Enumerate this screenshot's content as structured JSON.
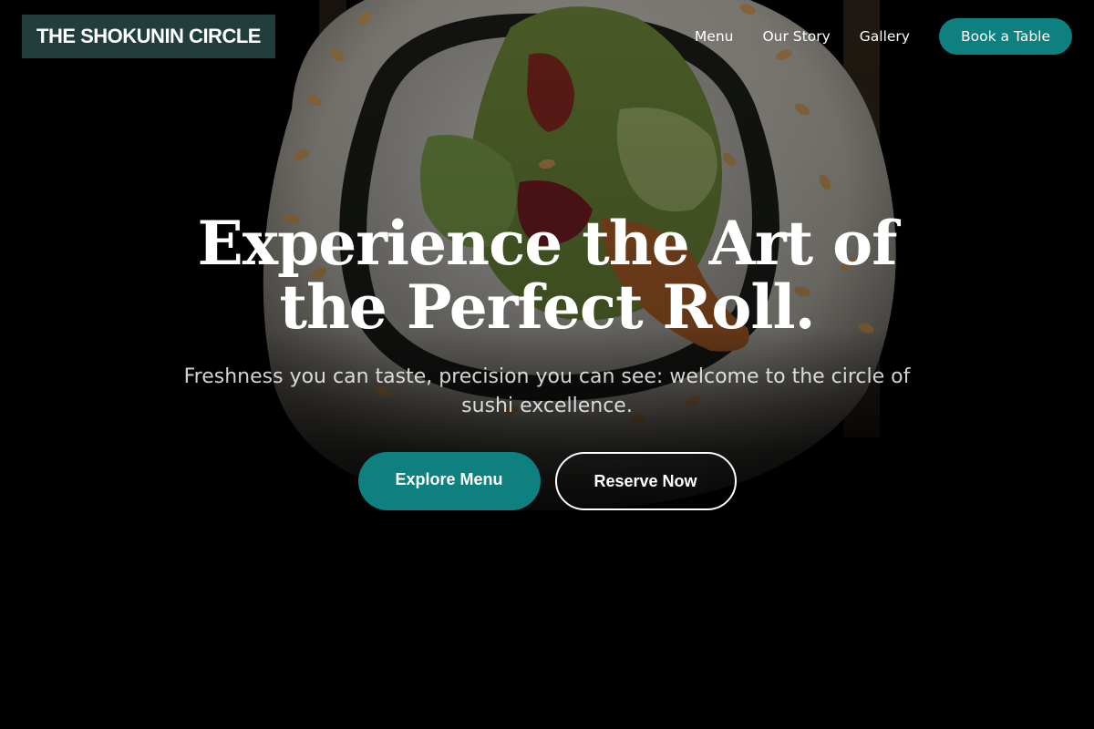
{
  "brand": {
    "logo_text": "THE SHOKUNIN CIRCLE"
  },
  "nav": {
    "items": [
      {
        "label": "Menu"
      },
      {
        "label": "Our Story"
      },
      {
        "label": "Gallery"
      }
    ],
    "cta_label": "Book a Table"
  },
  "hero": {
    "title": "Experience the Art of the Perfect Roll.",
    "subtitle": "Freshness you can taste, precision you can see: welcome to the circle of sushi excellence.",
    "primary_button": "Explore Menu",
    "secondary_button": "Reserve Now",
    "background_image": "sushi-roll-photo"
  },
  "colors": {
    "accent": "#0e8080",
    "logo_bg": "#264644",
    "background": "#000000",
    "text": "#ffffff"
  }
}
